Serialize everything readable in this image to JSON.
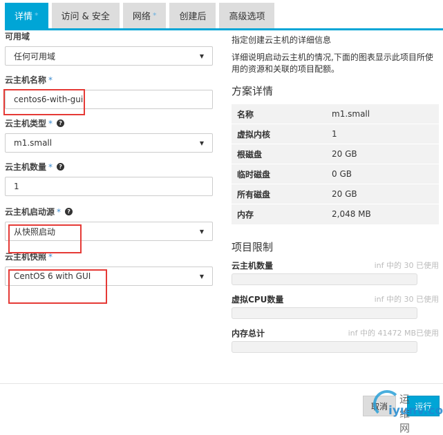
{
  "tabs": [
    {
      "label": "详情",
      "star": "*"
    },
    {
      "label": "访问 & 安全",
      "star": ""
    },
    {
      "label": "网络",
      "star": "*"
    },
    {
      "label": "创建后",
      "star": ""
    },
    {
      "label": "高级选项",
      "star": ""
    }
  ],
  "form": {
    "availability_zone": {
      "label": "可用域",
      "value": "任何可用域"
    },
    "instance_name": {
      "label": "云主机名称",
      "required": "*",
      "value": "centos6-with-gui"
    },
    "flavor": {
      "label": "云主机类型",
      "required": "*",
      "value": "m1.small"
    },
    "count": {
      "label": "云主机数量",
      "required": "*",
      "value": "1"
    },
    "boot_source": {
      "label": "云主机启动源",
      "required": "*",
      "value": "从快照启动"
    },
    "snapshot": {
      "label": "云主机快照",
      "required": "*",
      "value": "CentOS 6 with GUI"
    }
  },
  "info": {
    "title": "指定创建云主机的详细信息",
    "desc": "详细说明启动云主机的情况,下面的图表显示此项目所使用的资源和关联的项目配额。"
  },
  "flavor_details": {
    "title": "方案详情",
    "rows": [
      [
        "名称",
        "m1.small"
      ],
      [
        "虚拟内核",
        "1"
      ],
      [
        "根磁盘",
        "20 GB"
      ],
      [
        "临时磁盘",
        "0 GB"
      ],
      [
        "所有磁盘",
        "20 GB"
      ],
      [
        "内存",
        "2,048 MB"
      ]
    ]
  },
  "limits": {
    "title": "项目限制",
    "items": [
      {
        "label": "云主机数量",
        "usage": "inf 中的 30 已使用",
        "fraction": 0
      },
      {
        "label": "虚拟CPU数量",
        "usage": "inf 中的 30 已使用",
        "fraction": 0
      },
      {
        "label": "内存总计",
        "usage": "inf 中的 41472 MB已使用",
        "fraction": 0
      }
    ]
  },
  "buttons": {
    "cancel": "取消",
    "run": "运行"
  },
  "watermark": {
    "cn": "运维网",
    "en": "iyunv.com"
  },
  "colors": {
    "accent": "#00a5d6",
    "highlight": "#e53935"
  }
}
